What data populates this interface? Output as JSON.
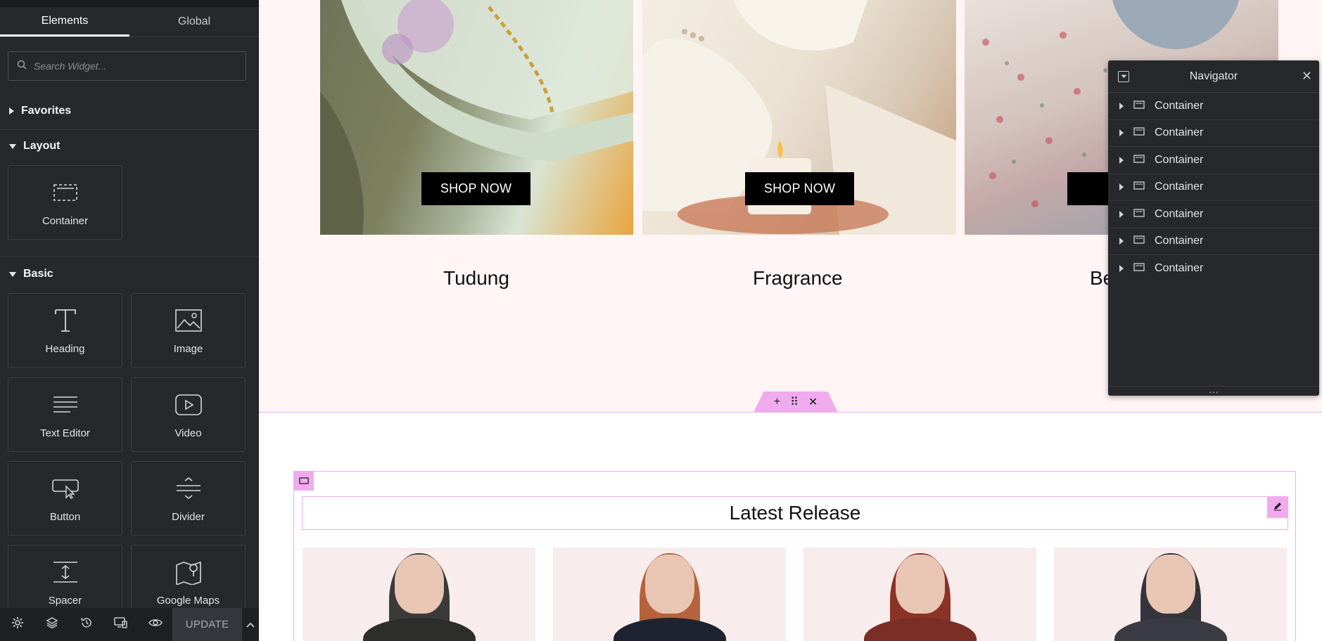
{
  "panel": {
    "tabs": [
      {
        "label": "Elements",
        "active": true
      },
      {
        "label": "Global",
        "active": false
      }
    ],
    "search": {
      "placeholder": "Search Widget..."
    },
    "categories": {
      "favorites": "Favorites",
      "layout": "Layout",
      "basic": "Basic"
    },
    "widgets": {
      "container": "Container",
      "heading": "Heading",
      "image": "Image",
      "text_editor": "Text Editor",
      "video": "Video",
      "button": "Button",
      "divider": "Divider",
      "spacer": "Spacer",
      "google_maps": "Google Maps"
    },
    "bottom_bar": {
      "icons": [
        "gear-icon",
        "layers-icon",
        "history-icon",
        "responsive-icon",
        "eye-icon",
        "chevron-up-icon"
      ],
      "update_label": "UPDATE"
    }
  },
  "canvas": {
    "cards": [
      {
        "button": "SHOP NOW",
        "title": "Tudung"
      },
      {
        "button": "SHOP NOW",
        "title": "Fragrance"
      },
      {
        "button": "SHO",
        "title": "Be"
      }
    ],
    "section_heading": "Latest Release",
    "colors": {
      "editor_accent": "#f0abef",
      "section_bg": "#fff5f5",
      "panel_bg": "#26282b"
    }
  },
  "navigator": {
    "title": "Navigator",
    "items": [
      "Container",
      "Container",
      "Container",
      "Container",
      "Container",
      "Container",
      "Container"
    ]
  }
}
